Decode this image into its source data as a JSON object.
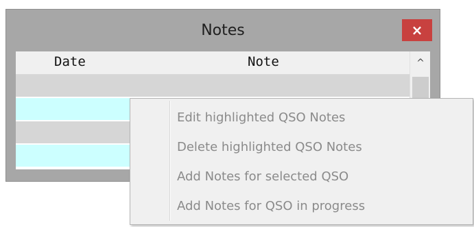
{
  "window": {
    "title": "Notes",
    "close_glyph": "×"
  },
  "grid": {
    "columns": [
      "Date",
      "Note"
    ],
    "scroll_up_glyph": "^",
    "row_colors": [
      "#d6d6d6",
      "#ccffff",
      "#d6d6d6",
      "#ccffff"
    ]
  },
  "context_menu": {
    "items": [
      {
        "label": "Edit highlighted QSO Notes",
        "enabled": false
      },
      {
        "label": "Delete highlighted QSO Notes",
        "enabled": false
      },
      {
        "label": "Add Notes for selected QSO",
        "enabled": false
      },
      {
        "label": "Add Notes for QSO in progress",
        "enabled": false
      }
    ]
  },
  "colors": {
    "close_button": "#c8413f",
    "window_frame": "#a7a7a7",
    "row_alt": "#ccffff",
    "menu_text_disabled": "#8a8a8a"
  }
}
